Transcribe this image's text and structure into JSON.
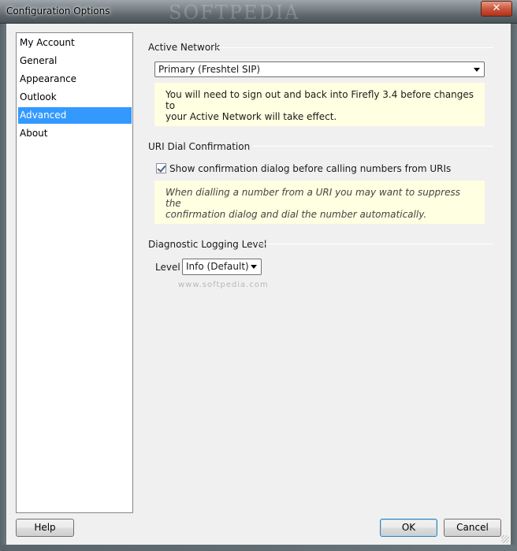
{
  "window": {
    "title": "Configuration Options",
    "watermark": "SOFTPEDIA",
    "close_glyph": "✕"
  },
  "nav": {
    "items": [
      {
        "label": "My Account"
      },
      {
        "label": "General"
      },
      {
        "label": "Appearance"
      },
      {
        "label": "Outlook"
      },
      {
        "label": "Advanced",
        "selected": true
      },
      {
        "label": "About"
      }
    ]
  },
  "active_network": {
    "heading": "Active Network",
    "selected": "Primary (Freshtel SIP)",
    "note_line1": "You will need to sign out and back into Firefly 3.4 before changes to",
    "note_line2": "your Active Network will take effect."
  },
  "uri_dial": {
    "heading": "URI Dial Confirmation",
    "checkbox_label": "Show confirmation dialog before calling numbers from URIs",
    "checked": true,
    "note_line1": "When dialling a number from a URI you may want to suppress the",
    "note_line2": "confirmation dialog and dial the number automatically."
  },
  "logging": {
    "heading": "Diagnostic Logging Level",
    "level_label": "Level",
    "level_value": "Info (Default)"
  },
  "footer": {
    "help_label": "Help",
    "ok_label": "OK",
    "cancel_label": "Cancel"
  },
  "softpedia_watermark": "www.softpedia.com",
  "colors": {
    "selection": "#3399ff",
    "note_background": "#ffffe1",
    "close_button": "#c9583d"
  }
}
